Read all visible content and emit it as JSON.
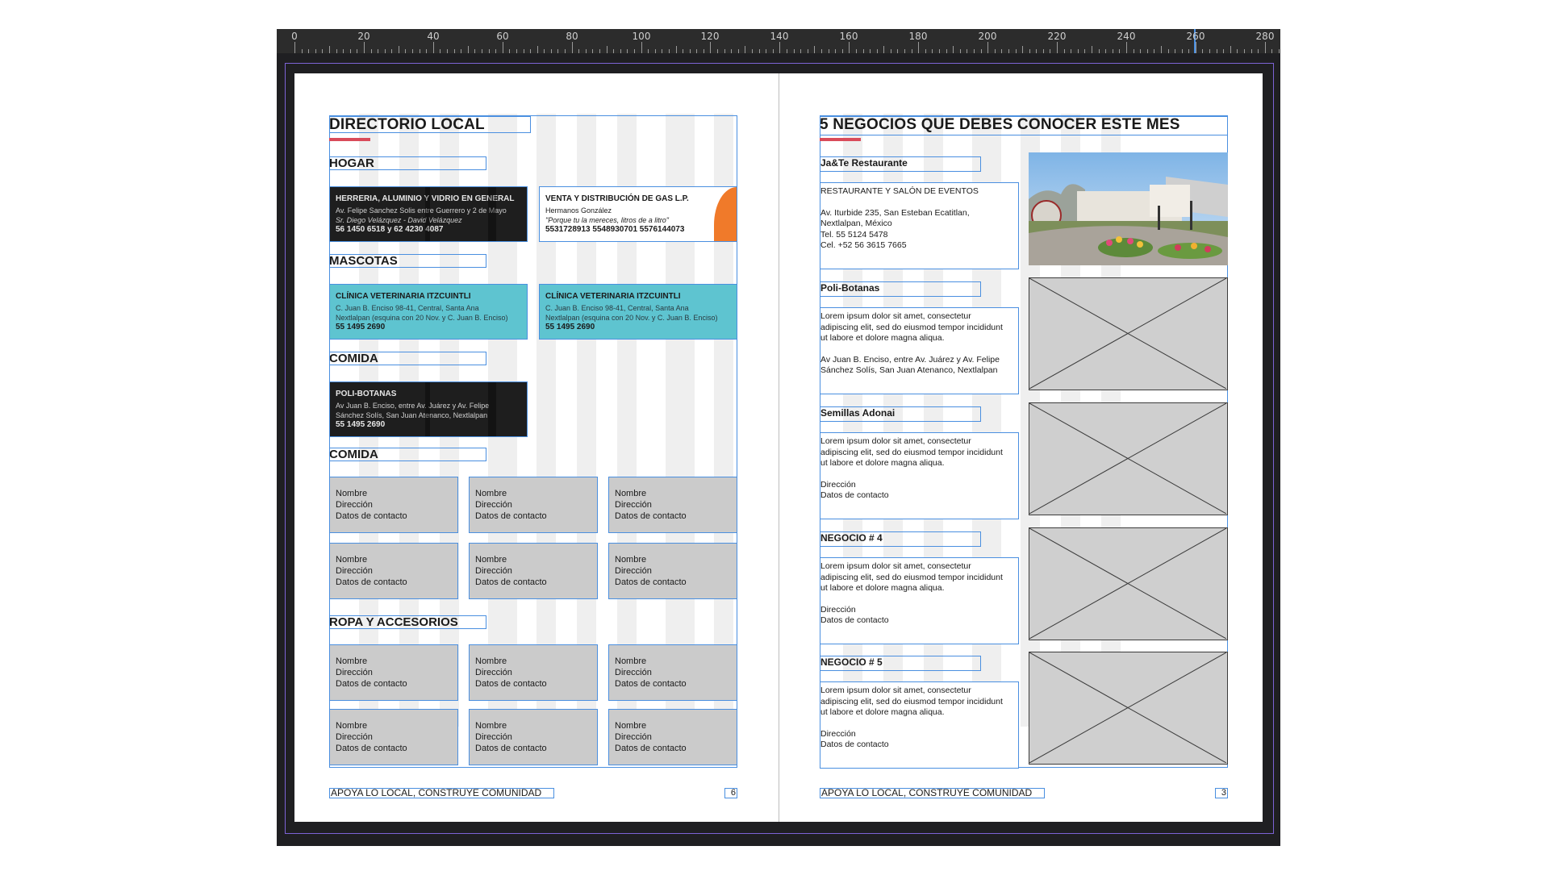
{
  "ruler": {
    "labels": [
      "0",
      "20",
      "40",
      "60",
      "80",
      "100",
      "120",
      "140",
      "160",
      "180",
      "200",
      "220",
      "240",
      "260",
      "280"
    ]
  },
  "left_page": {
    "title": "DIRECTORIO LOCAL",
    "sections": {
      "hogar": "HOGAR",
      "mascotas": "MASCOTAS",
      "comida1": "COMIDA",
      "comida2": "COMIDA",
      "ropa": "ROPA Y ACCESORIOS"
    },
    "cards": {
      "herreria": {
        "title": "HERRERIA, ALUMINIO Y VIDRIO EN GENERAL",
        "line1": "Av. Felipe Sanchez Solis entre Guerrero y 2 de Mayo",
        "line2": "Sr. Diego Velázquez - David Velázquez",
        "phone": "56 1450 6518 y 62 4230 4087"
      },
      "gas": {
        "title": "VENTA Y DISTRIBUCIÓN DE GAS L.P.",
        "line1": "Hermanos González",
        "line2": "\"Porque tu la mereces, litros de a litro\"",
        "phone": "5531728913  5548930701  5576144073"
      },
      "vet1": {
        "title": "CLÍNICA VETERINARIA ITZCUINTLI",
        "line1": "C. Juan B. Enciso 98-41, Central, Santa Ana",
        "line2": "Nextlalpan (esquina con 20 Nov. y C. Juan B. Enciso)",
        "phone": "55 1495 2690"
      },
      "vet2": {
        "title": "CLÍNICA VETERINARIA ITZCUINTLI",
        "line1": "C. Juan B. Enciso 98-41, Central, Santa Ana",
        "line2": "Nextlalpan (esquina con 20 Nov. y C. Juan B. Enciso)",
        "phone": "55 1495 2690"
      },
      "poli": {
        "title": "POLI-BOTANAS",
        "line1": "Av Juan B. Enciso, entre Av. Juárez y Av. Felipe",
        "line2": "Sánchez Solís, San Juan Atenanco, Nextlalpan",
        "phone": "55 1495 2690"
      }
    },
    "placeholder": {
      "name": "Nombre",
      "address": "Dirección",
      "contact": "Datos de contacto"
    },
    "footer": "APOYA LO LOCAL, CONSTRUYE COMUNIDAD",
    "page_number": "6"
  },
  "right_page": {
    "title": "5 NEGOCIOS QUE DEBES CONOCER ESTE MES",
    "businesses": [
      {
        "name": "Ja&Te Restaurante",
        "lines": [
          "RESTAURANTE Y SALÓN DE EVENTOS",
          "",
          "Av. Iturbide 235, San Esteban Ecatitlan,",
          "Nextlalpan, México",
          "Tel. 55 5124 5478",
          "Cel. +52 56 3615 7665"
        ]
      },
      {
        "name": "Poli-Botanas",
        "lines": [
          "Lorem ipsum dolor sit amet, consectetur",
          "adipiscing elit, sed do eiusmod tempor incididunt",
          "ut labore et dolore magna aliqua.",
          "",
          "Av Juan B. Enciso, entre Av. Juárez y Av. Felipe",
          "Sánchez Solís, San Juan Atenanco, Nextlalpan"
        ]
      },
      {
        "name": "Semillas Adonai",
        "lines": [
          "Lorem ipsum dolor sit amet, consectetur",
          "adipiscing elit, sed do eiusmod tempor incididunt",
          "ut labore et dolore magna aliqua.",
          "",
          "Dirección",
          "Datos de contacto"
        ]
      },
      {
        "name": "NEGOCIO # 4",
        "lines": [
          "Lorem ipsum dolor sit amet, consectetur",
          "adipiscing elit, sed do eiusmod tempor incididunt",
          "ut labore et dolore magna aliqua.",
          "",
          "Dirección",
          "Datos de contacto"
        ]
      },
      {
        "name": "NEGOCIO # 5",
        "lines": [
          "Lorem ipsum dolor sit amet, consectetur",
          "adipiscing elit, sed do eiusmod tempor incididunt",
          "ut labore et dolore magna aliqua.",
          "",
          "Dirección",
          "Datos de contacto"
        ]
      }
    ],
    "footer": "APOYA LO LOCAL, CONSTRUYE COMUNIDAD",
    "page_number": "3"
  },
  "colors": {
    "frame_blue": "#4a8fe0",
    "accent_red": "#d94b5a",
    "teal_card": "#5ec4d0",
    "dark_card": "#1e1e1e",
    "gas_orange": "#f07a2a",
    "placeholder_gray": "#cbcbcb"
  }
}
